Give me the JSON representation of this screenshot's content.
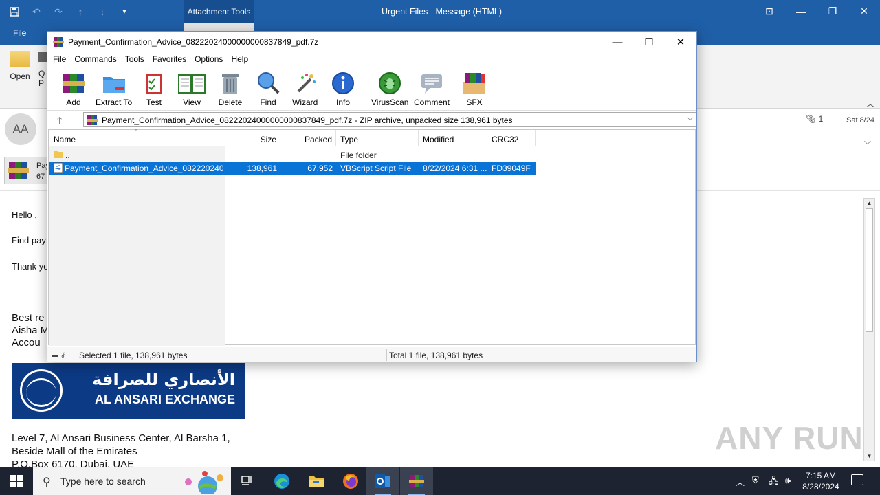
{
  "outlook": {
    "context_tab": "Attachment Tools",
    "window_title": "Urgent Files  -  Message (HTML)",
    "file_tab": "File",
    "ribbon": {
      "open_label": "Open",
      "q_label_1": "Q",
      "q_label_2": "P"
    },
    "sender_initials": "AA",
    "attachment": {
      "name": "Pay",
      "size": "67"
    },
    "attachment_count": "1",
    "date": "Sat 8/24",
    "body": {
      "greeting": "Hello ,",
      "line1": "Find pay",
      "line2": "Thank yo",
      "sig1": "Best re",
      "sig2": "Aisha M",
      "sig3": "Accou",
      "addr1": "Level 7, Al Ansari Business Center, Al Barsha 1,",
      "addr2": "Beside Mall of the Emirates",
      "addr3": "P.O.Box 6170, Dubai, UAE"
    },
    "logo": {
      "arabic": "الأنصاري للصرافة",
      "english": "AL ANSARI EXCHANGE"
    },
    "watermark": "ANY RUN"
  },
  "winrar": {
    "title": "Payment_Confirmation_Advice_08222024000000000837849_pdf.7z",
    "menu": [
      "File",
      "Commands",
      "Tools",
      "Favorites",
      "Options",
      "Help"
    ],
    "toolbar": {
      "add": "Add",
      "extract": "Extract To",
      "test": "Test",
      "view": "View",
      "delete": "Delete",
      "find": "Find",
      "wizard": "Wizard",
      "info": "Info",
      "virusscan": "VirusScan",
      "comment": "Comment",
      "sfx": "SFX"
    },
    "address": "Payment_Confirmation_Advice_08222024000000000837849_pdf.7z - ZIP archive, unpacked size 138,961 bytes",
    "columns": {
      "name": "Name",
      "size": "Size",
      "packed": "Packed",
      "type": "Type",
      "modified": "Modified",
      "crc": "CRC32"
    },
    "rows": [
      {
        "name": "..",
        "size": "",
        "packed": "",
        "type": "File folder",
        "modified": "",
        "crc": ""
      },
      {
        "name": "Payment_Confirmation_Advice_082220240...",
        "size": "138,961",
        "packed": "67,952",
        "type": "VBScript Script File",
        "modified": "8/22/2024 6:31 ...",
        "crc": "FD39049F"
      }
    ],
    "status_left": "Selected 1 file, 138,961 bytes",
    "status_right": "Total 1 file, 138,961 bytes"
  },
  "taskbar": {
    "search_placeholder": "Type here to search",
    "time": "7:15 AM",
    "date": "8/28/2024"
  },
  "colors": {
    "outlook_blue": "#1f5fa8",
    "selection": "#0a73d6",
    "taskbar": "#1d2330",
    "ansari_blue": "#0c3a84"
  }
}
